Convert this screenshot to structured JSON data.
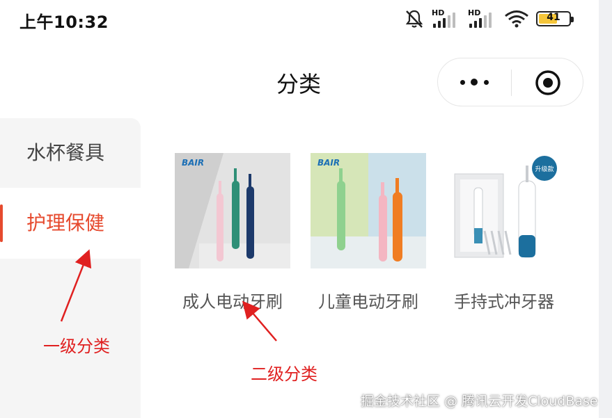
{
  "status_bar": {
    "time": "上午10:32",
    "signal1_label": "HD",
    "signal2_label": "HD",
    "battery": "41",
    "icons": [
      "bell-muted-icon",
      "signal-icon",
      "signal-icon",
      "wifi-icon",
      "battery-icon"
    ],
    "battery_color": "#f5c63a"
  },
  "nav": {
    "title": "分类",
    "more_icon": "more-dots-icon",
    "close_icon": "target-close-icon"
  },
  "sidebar": {
    "items": [
      {
        "label": "水杯餐具",
        "active": false
      },
      {
        "label": "护理保健",
        "active": true
      }
    ],
    "active_color": "#e64a2e"
  },
  "products": [
    {
      "name": "成人电动牙刷",
      "image": "adult-electric-toothbrush-image",
      "brand": "BAIR"
    },
    {
      "name": "儿童电动牙刷",
      "image": "kids-electric-toothbrush-image",
      "brand": "BAIR"
    },
    {
      "name": "手持式冲牙器",
      "image": "handheld-water-flosser-image",
      "badge": "升级款"
    }
  ],
  "annotations": {
    "level1": "一级分类",
    "level2": "二级分类",
    "color": "#e02020"
  },
  "watermark": "掘金技术社区 @ 腾讯云开发CloudBase"
}
